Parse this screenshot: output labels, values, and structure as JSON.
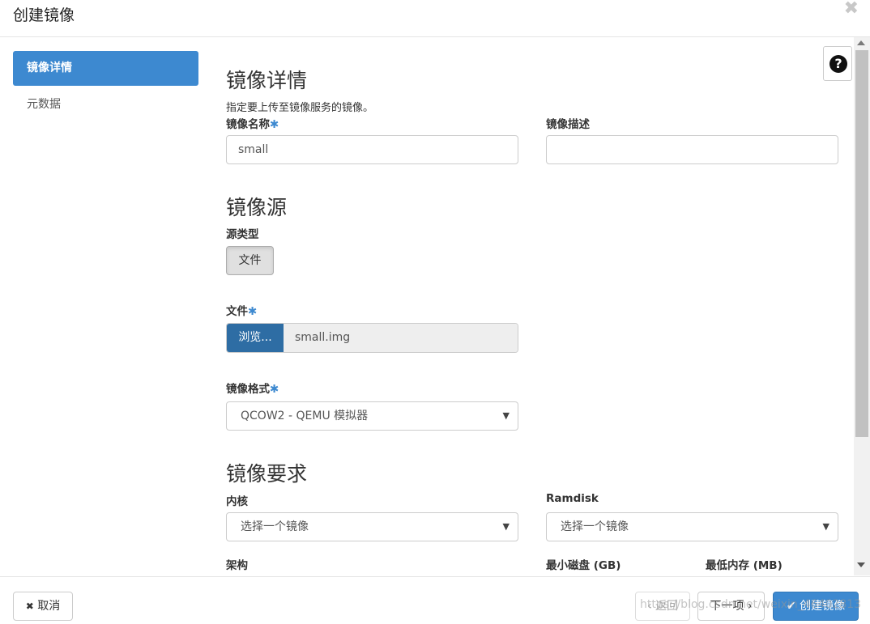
{
  "modal": {
    "title": "创建镜像",
    "close_glyph": "✖"
  },
  "nav": {
    "items": [
      {
        "label": "镜像详情",
        "active": true
      },
      {
        "label": "元数据",
        "active": false
      }
    ]
  },
  "help_button": {
    "glyph": "?"
  },
  "details": {
    "section_title": "镜像详情",
    "help_text": "指定要上传至镜像服务的镜像。",
    "name_label": "镜像名称",
    "name_value": "small",
    "desc_label": "镜像描述",
    "desc_value": ""
  },
  "source": {
    "section_title": "镜像源",
    "type_label": "源类型",
    "type_button": "文件",
    "file_label": "文件",
    "browse_label": "浏览...",
    "file_name": "small.img",
    "format_label": "镜像格式",
    "format_value": "QCOW2 - QEMU 模拟器"
  },
  "requirements": {
    "section_title": "镜像要求",
    "kernel_label": "内核",
    "kernel_value": "选择一个镜像",
    "ramdisk_label": "Ramdisk",
    "ramdisk_value": "选择一个镜像",
    "arch_label": "架构",
    "min_disk_label": "最小磁盘 (GB)",
    "min_ram_label": "最低内存 (MB)"
  },
  "required_marker": "✱",
  "select_caret": "▼",
  "footer": {
    "cancel_label": "取消",
    "back_label": "‹ 返回",
    "next_label": "下一项 ›",
    "create_label": "创建镜像"
  },
  "watermark": "https://blog.csdn.net/weixin_46402813",
  "colors": {
    "primary": "#3d89d0",
    "browse": "#2e6da4"
  }
}
